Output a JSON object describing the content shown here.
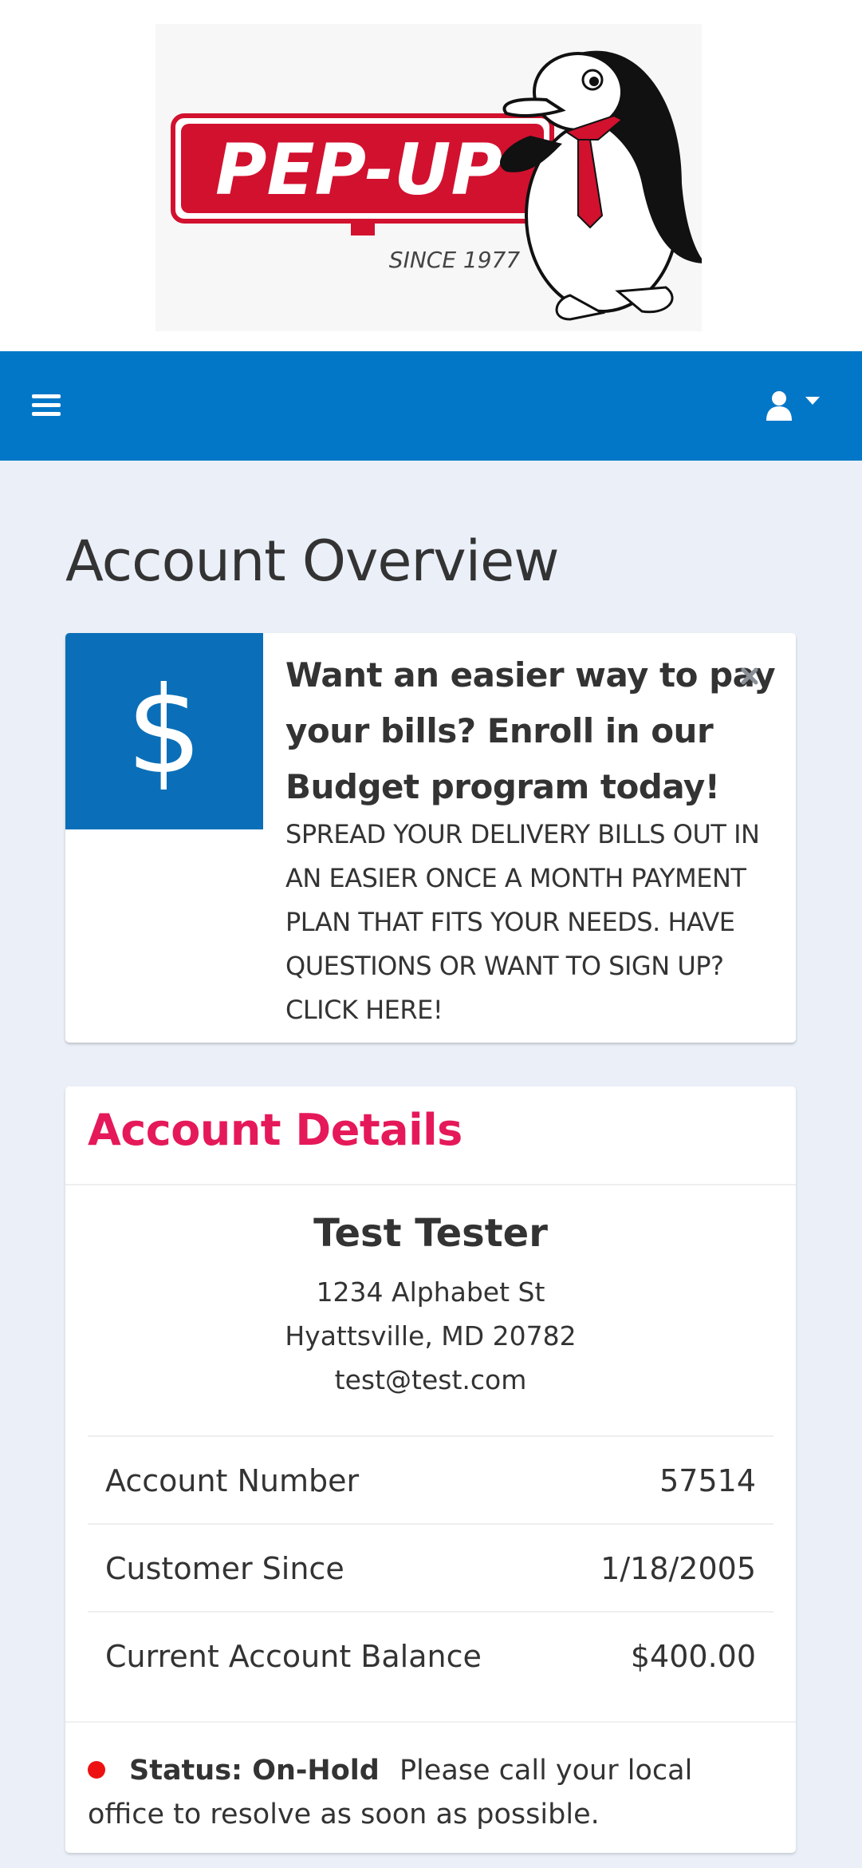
{
  "logo": {
    "brand_text": "PEP-UP",
    "since_text": "SINCE 1977"
  },
  "navbar": {
    "background_color": "#0277c7",
    "menu_icon": "hamburger-icon",
    "user_icon": "user-icon",
    "dropdown_icon": "caret-down-icon"
  },
  "page": {
    "title": "Account Overview"
  },
  "promo": {
    "icon": "$",
    "icon_background": "#0a6fb8",
    "heading": "Want an easier way to pay your bills? Enroll in our Budget program today!",
    "body": "SPREAD YOUR DELIVERY BILLS OUT IN AN EASIER ONCE A MONTH PAYMENT PLAN THAT FITS YOUR NEEDS. HAVE QUESTIONS OR WANT TO SIGN UP? CLICK HERE!",
    "close_icon": "close-icon"
  },
  "account": {
    "title": "Account Details",
    "title_color": "#e5195a",
    "customer": {
      "name": "Test Tester",
      "street": "1234 Alphabet St",
      "city_line": "Hyattsville, MD 20782",
      "email": "test@test.com"
    },
    "rows": [
      {
        "label": "Account Number",
        "value": "57514"
      },
      {
        "label": "Customer Since",
        "value": "1/18/2005"
      },
      {
        "label": "Current Account Balance",
        "value": "$400.00"
      }
    ],
    "status": {
      "label": "Status: On-Hold",
      "message": "Please call your local office to resolve as soon as possible.",
      "dot_color": "#ee1111"
    }
  }
}
